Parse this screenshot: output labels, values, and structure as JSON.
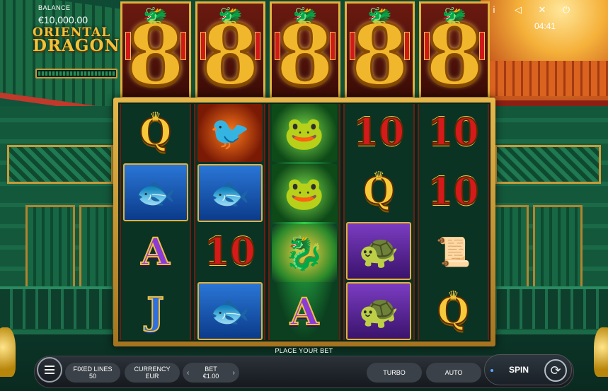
{
  "hud": {
    "balance_label": "BALANCE",
    "balance_value": "€10,000.00",
    "logo_line1": "ORIENTAL",
    "logo_line2": "DRAGON",
    "clock": "04:41",
    "icons": [
      "info-icon",
      "sound-icon",
      "fullscreen-icon",
      "power-icon"
    ],
    "icon_glyphs": [
      "i",
      "◁",
      "✕",
      "⏻"
    ]
  },
  "eights": [
    "8",
    "8",
    "8",
    "8",
    "8"
  ],
  "reels": [
    [
      "Q",
      "fish",
      "A",
      "J"
    ],
    [
      "phoenix",
      "fish",
      "10",
      "fish"
    ],
    [
      "toad",
      "toad",
      "dragon",
      "A"
    ],
    [
      "10",
      "Q",
      "turtle",
      "turtle"
    ],
    [
      "10",
      "10",
      "scroll",
      "Q"
    ]
  ],
  "bottom": {
    "place_bet": "PLACE YOUR BET",
    "fixed_lines_label": "FIXED LINES",
    "fixed_lines_value": "50",
    "currency_label": "CURRENCY",
    "currency_value": "EUR",
    "bet_label": "BET",
    "bet_value": "€1.00",
    "turbo_label": "TURBO",
    "auto_label": "AUTO",
    "spin_label": "SPIN"
  },
  "colors": {
    "accent_gold": "#f1b72c",
    "bar_dark": "#15191e"
  }
}
